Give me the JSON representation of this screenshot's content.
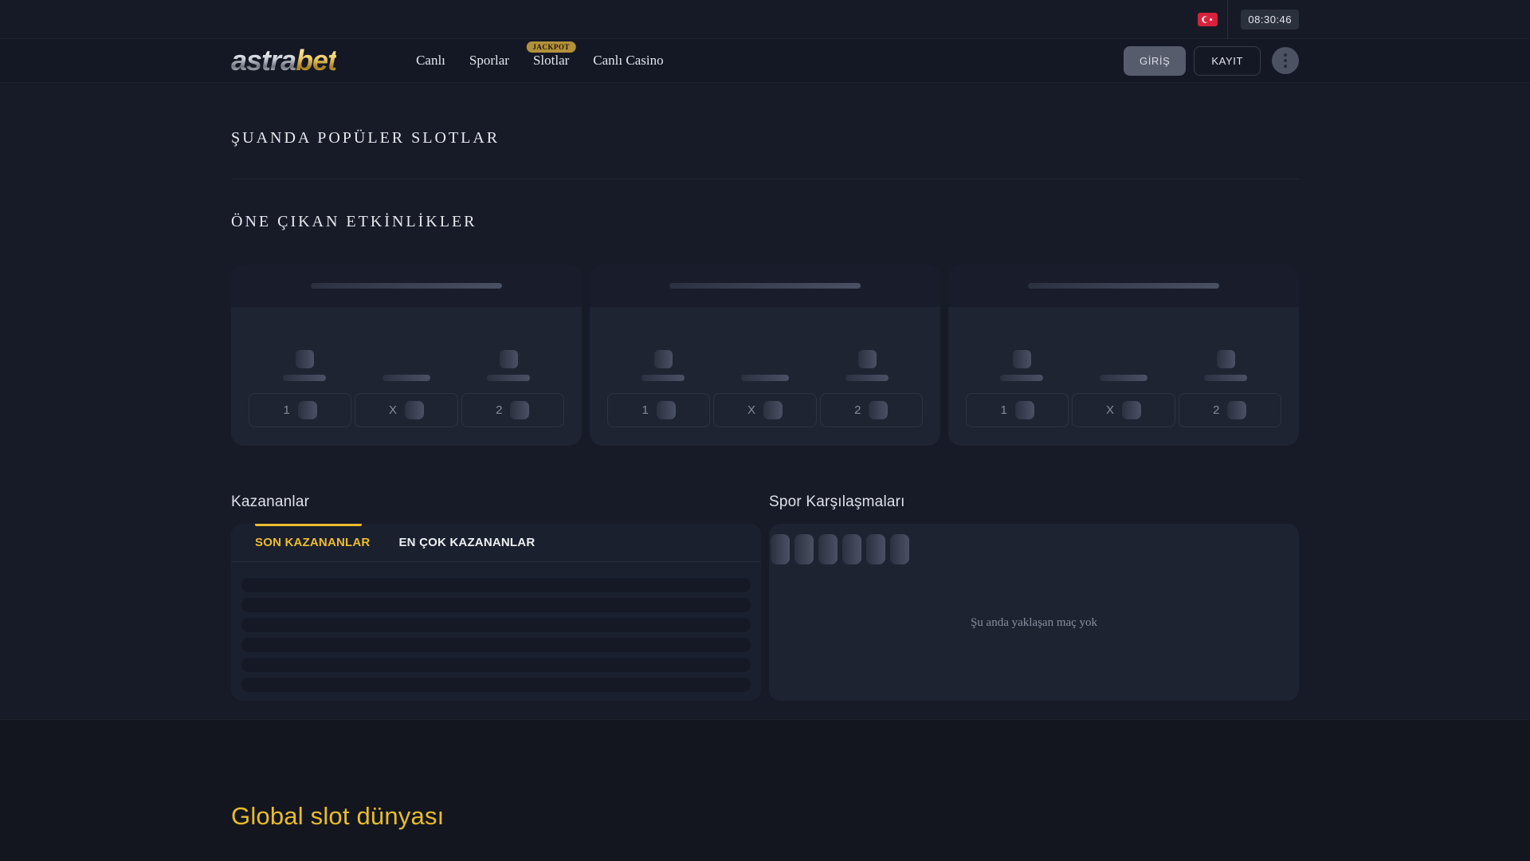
{
  "topbar": {
    "time": "08:30:46"
  },
  "header": {
    "logo_silver": "astra",
    "logo_gold": "bet",
    "nav": {
      "live": "Canlı",
      "sports": "Sporlar",
      "slots": "Slotlar",
      "slots_badge": "JACKPOT",
      "live_casino": "Canlı Casino"
    },
    "login_button": "GİRİŞ",
    "register_button": "KAYIT"
  },
  "main": {
    "popular_slots_title": "ŞUANDA POPÜLER SLOTLAR",
    "featured_events_title": "ÖNE ÇIKAN ETKİNLİKLER",
    "odds_labels": {
      "home": "1",
      "draw": "X",
      "away": "2"
    },
    "winners": {
      "title": "Kazananlar",
      "tab_recent": "SON KAZANANLAR",
      "tab_top": "EN ÇOK KAZANANLAR"
    },
    "sports": {
      "title": "Spor Karşılaşmaları",
      "empty_text": "Şu anda yaklaşan maç yok"
    },
    "bottom_title": "Global slot dünyası"
  },
  "colors": {
    "accent_gold": "#eebc2d",
    "flag_red": "#d8213b",
    "page_bg": "#171b28",
    "header_bg": "#141825",
    "event_card_bg": "#1f2433",
    "winners_panel_bg": "#1b202e",
    "sports_panel_bg": "#1e2332",
    "bottom_bg": "#13161f"
  }
}
